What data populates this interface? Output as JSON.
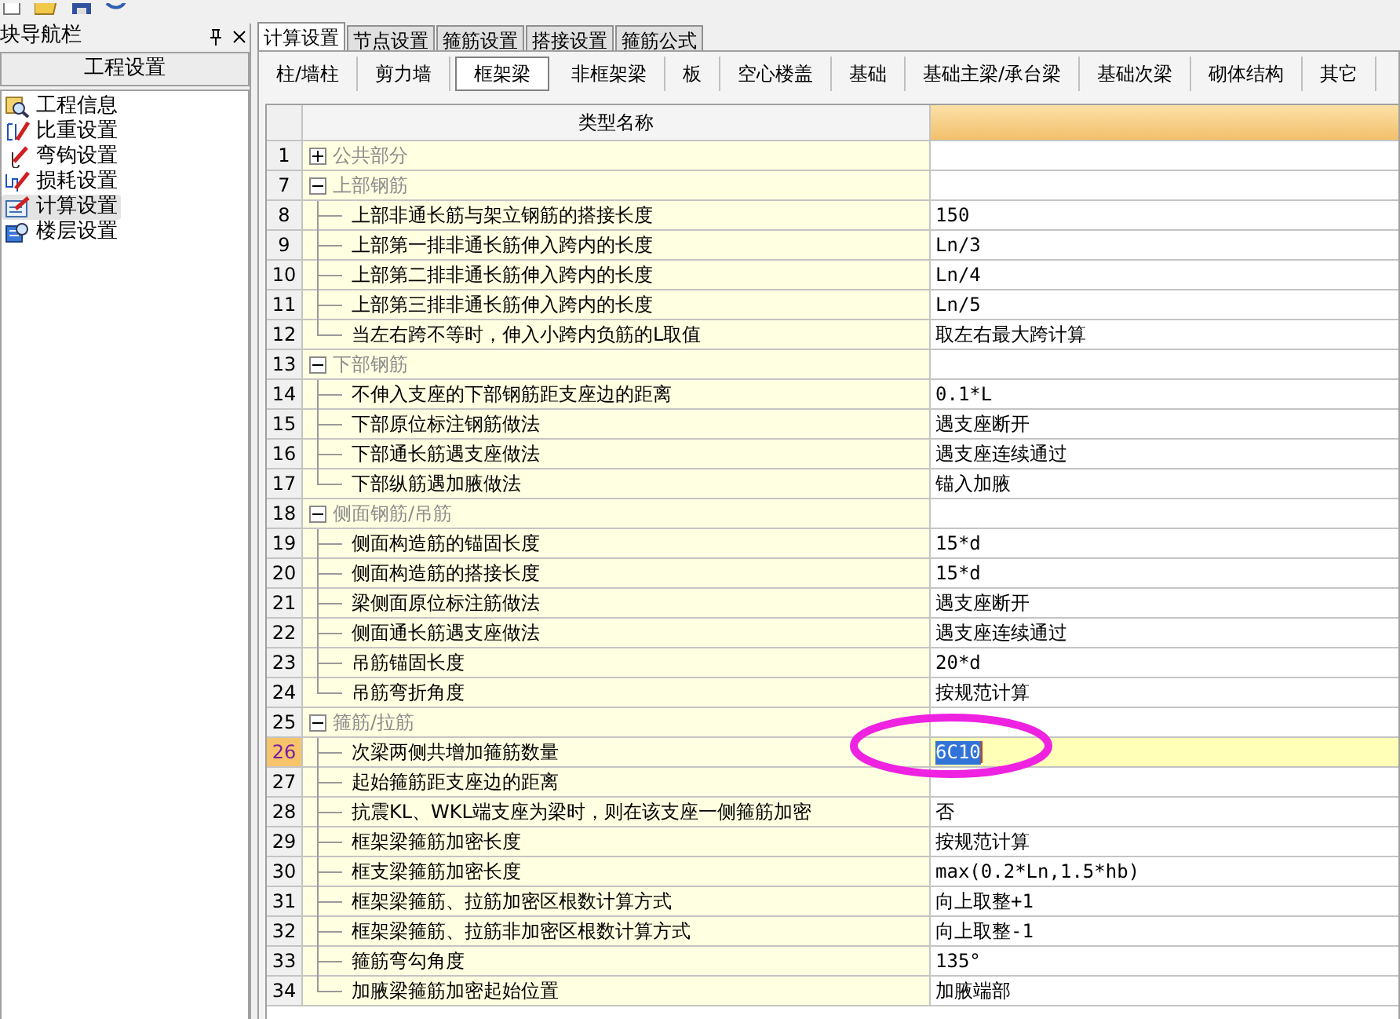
{
  "nav_panel": {
    "title": "块导航栏",
    "section_button": "工程设置",
    "items": [
      {
        "label": "工程信息",
        "selected": false
      },
      {
        "label": "比重设置",
        "selected": false
      },
      {
        "label": "弯钩设置",
        "selected": false
      },
      {
        "label": "损耗设置",
        "selected": false
      },
      {
        "label": "计算设置",
        "selected": true
      },
      {
        "label": "楼层设置",
        "selected": false
      }
    ]
  },
  "tabs": [
    {
      "label": "计算设置",
      "selected": true
    },
    {
      "label": "节点设置",
      "selected": false
    },
    {
      "label": "箍筋设置",
      "selected": false
    },
    {
      "label": "搭接设置",
      "selected": false
    },
    {
      "label": "箍筋公式",
      "selected": false
    }
  ],
  "subtabs": [
    {
      "label": "柱/墙柱",
      "selected": false
    },
    {
      "label": "剪力墙",
      "selected": false
    },
    {
      "label": "框架梁",
      "selected": true
    },
    {
      "label": "非框架梁",
      "selected": false
    },
    {
      "label": "板",
      "selected": false
    },
    {
      "label": "空心楼盖",
      "selected": false
    },
    {
      "label": "基础",
      "selected": false
    },
    {
      "label": "基础主梁/承台梁",
      "selected": false
    },
    {
      "label": "基础次梁",
      "selected": false
    },
    {
      "label": "砌体结构",
      "selected": false
    },
    {
      "label": "其它",
      "selected": false
    }
  ],
  "table": {
    "columns": [
      "类型名称"
    ],
    "groups": [
      {
        "num": "1",
        "name": "公共部分",
        "expanded": false,
        "selected": false
      },
      {
        "num": "7",
        "name": "上部钢筋",
        "expanded": true,
        "selected": false,
        "children": [
          {
            "num": "8",
            "name": "上部非通长筋与架立钢筋的搭接长度",
            "value": "150",
            "selected": false
          },
          {
            "num": "9",
            "name": "上部第一排非通长筋伸入跨内的长度",
            "value": "Ln/3",
            "selected": false
          },
          {
            "num": "10",
            "name": "上部第二排非通长筋伸入跨内的长度",
            "value": "Ln/4",
            "selected": false
          },
          {
            "num": "11",
            "name": "上部第三排非通长筋伸入跨内的长度",
            "value": "Ln/5",
            "selected": false
          },
          {
            "num": "12",
            "name": "当左右跨不等时，伸入小跨内负筋的L取值",
            "value": "取左右最大跨计算",
            "selected": false
          }
        ]
      },
      {
        "num": "13",
        "name": "下部钢筋",
        "expanded": true,
        "selected": false,
        "children": [
          {
            "num": "14",
            "name": "不伸入支座的下部钢筋距支座边的距离",
            "value": "0.1*L",
            "selected": false
          },
          {
            "num": "15",
            "name": "下部原位标注钢筋做法",
            "value": "遇支座断开",
            "selected": false
          },
          {
            "num": "16",
            "name": "下部通长筋遇支座做法",
            "value": "遇支座连续通过",
            "selected": false
          },
          {
            "num": "17",
            "name": "下部纵筋遇加腋做法",
            "value": "锚入加腋",
            "selected": false
          }
        ]
      },
      {
        "num": "18",
        "name": "侧面钢筋/吊筋",
        "expanded": true,
        "selected": false,
        "children": [
          {
            "num": "19",
            "name": "侧面构造筋的锚固长度",
            "value": "15*d",
            "selected": false
          },
          {
            "num": "20",
            "name": "侧面构造筋的搭接长度",
            "value": "15*d",
            "selected": false
          },
          {
            "num": "21",
            "name": "梁侧面原位标注筋做法",
            "value": "遇支座断开",
            "selected": false
          },
          {
            "num": "22",
            "name": "侧面通长筋遇支座做法",
            "value": "遇支座连续通过",
            "selected": false
          },
          {
            "num": "23",
            "name": "吊筋锚固长度",
            "value": "20*d",
            "selected": false
          },
          {
            "num": "24",
            "name": "吊筋弯折角度",
            "value": "按规范计算",
            "selected": false
          }
        ]
      },
      {
        "num": "25",
        "name": "箍筋/拉筋",
        "expanded": true,
        "selected": false,
        "children": [
          {
            "num": "26",
            "name": "次梁两侧共增加箍筋数量",
            "value": "6C10",
            "selected": true
          },
          {
            "num": "27",
            "name": "起始箍筋距支座边的距离",
            "selected": false
          },
          {
            "num": "28",
            "name": "抗震KL、WKL端支座为梁时，则在该支座一侧箍筋加密",
            "value": "否",
            "selected": false
          },
          {
            "num": "29",
            "name": "框架梁箍筋加密长度",
            "value": "按规范计算",
            "selected": false
          },
          {
            "num": "30",
            "name": "框支梁箍筋加密长度",
            "value": "max(0.2*Ln,1.5*hb)",
            "selected": false
          },
          {
            "num": "31",
            "name": "框架梁箍筋、拉筋加密区根数计算方式",
            "value": "向上取整+1",
            "selected": false
          },
          {
            "num": "32",
            "name": "框架梁箍筋、拉筋非加密区根数计算方式",
            "value": "向上取整-1",
            "selected": false
          },
          {
            "num": "33",
            "name": "箍筋弯勾角度",
            "value": "135°",
            "selected": false
          },
          {
            "num": "34",
            "name": "加腋梁箍筋加密起始位置",
            "value": "加腋端部",
            "selected": false
          }
        ]
      }
    ]
  }
}
